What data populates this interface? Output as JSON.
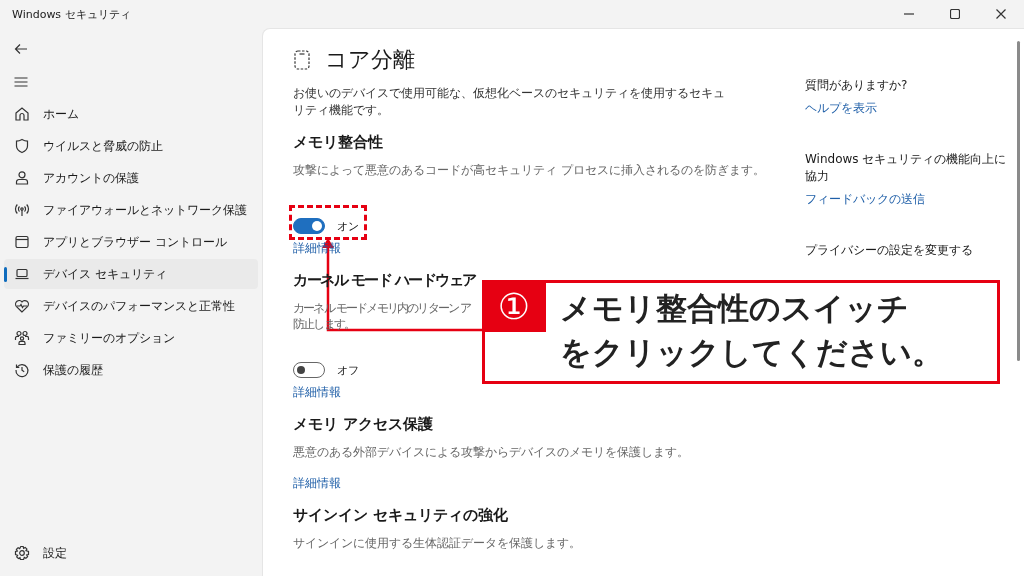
{
  "window": {
    "title": "Windows セキュリティ"
  },
  "sidebar": {
    "items": [
      {
        "label": "ホーム",
        "selected": false
      },
      {
        "label": "ウイルスと脅威の防止",
        "selected": false
      },
      {
        "label": "アカウントの保護",
        "selected": false
      },
      {
        "label": "ファイアウォールとネットワーク保護",
        "selected": false
      },
      {
        "label": "アプリとブラウザー コントロール",
        "selected": false
      },
      {
        "label": "デバイス セキュリティ",
        "selected": true
      },
      {
        "label": "デバイスのパフォーマンスと正常性",
        "selected": false
      },
      {
        "label": "ファミリーのオプション",
        "selected": false
      },
      {
        "label": "保護の履歴",
        "selected": false
      }
    ],
    "settings": {
      "label": "設定"
    }
  },
  "page": {
    "title": "コア分離",
    "description": "お使いのデバイスで使用可能な、仮想化ベースのセキュリティを使用するセキュリティ機能です。",
    "sections": [
      {
        "heading": "メモリ整合性",
        "description_lines": [
          "攻撃によって悪意のあるコードが高セキュリティ プロセスに挿入されるのを防ぎます。"
        ],
        "toggle": {
          "on": true,
          "label": "オン"
        },
        "link": "詳細情報"
      },
      {
        "heading": "カーネル モード ハードウェア",
        "description_lines": [
          "カーネル モードメモリ内のリターン ア",
          "防止します。"
        ],
        "toggle": {
          "on": false,
          "label": "オフ"
        },
        "link": "詳細情報"
      },
      {
        "heading": "メモリ アクセス保護",
        "description_lines": [
          "悪意のある外部デバイスによる攻撃からデバイスのメモリを保護します。"
        ],
        "link": "詳細情報"
      },
      {
        "heading": "サインイン セキュリティの強化",
        "description_lines": [
          "サインインに使用する生体認証データを保護します。"
        ]
      }
    ]
  },
  "aside": [
    {
      "heading": "質問がありますか?",
      "link": "ヘルプを表示"
    },
    {
      "heading": "Windows セキュリティの機能向上に協力",
      "link": "フィードバックの送信"
    },
    {
      "heading": "プライバシーの設定を変更する"
    }
  ],
  "annotation": {
    "number": "①",
    "lines": [
      "メモリ整合性のスイッチ",
      "をクリックしてください。"
    ]
  }
}
